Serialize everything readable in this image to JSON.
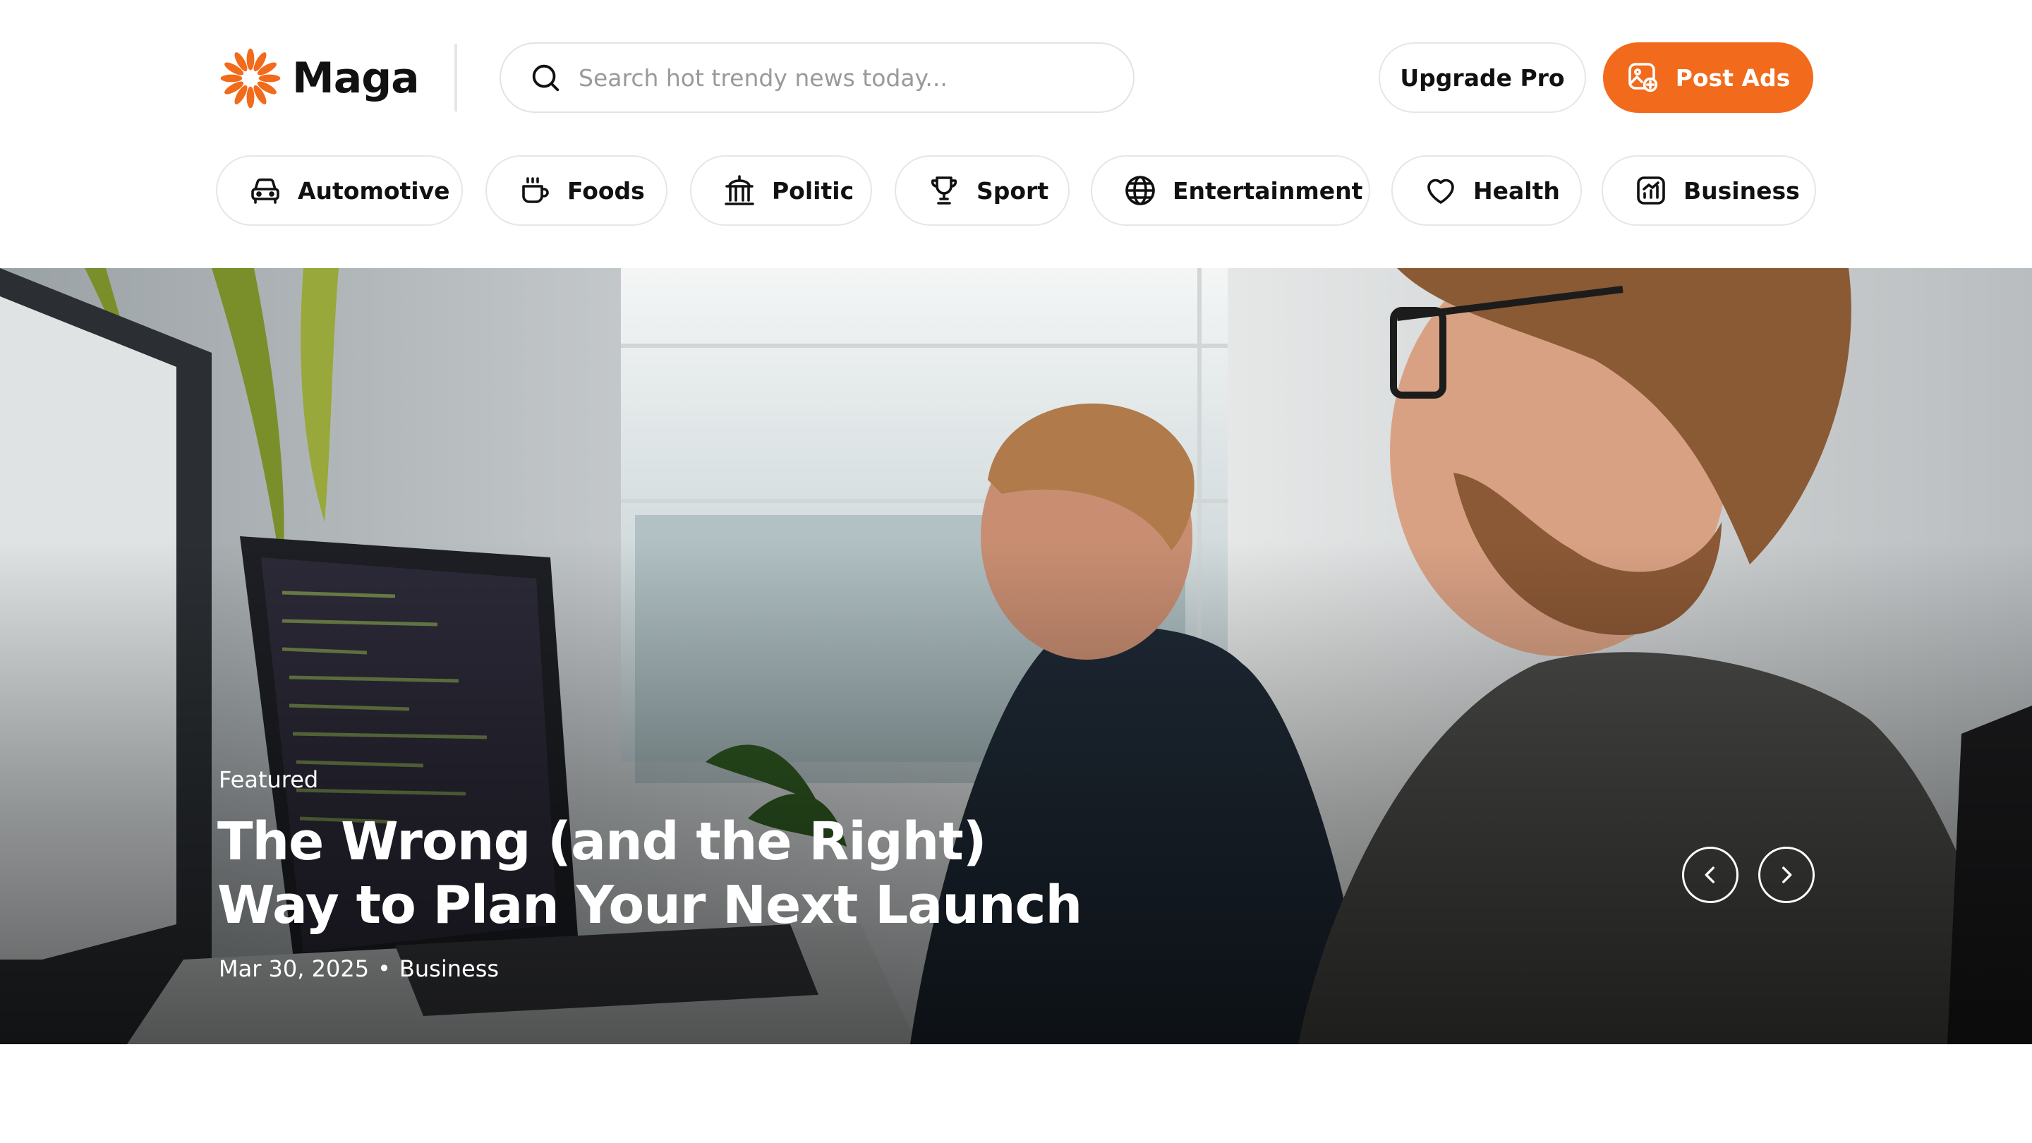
{
  "brand": {
    "name": "Maga",
    "accent_color": "#f26a1b",
    "logo_icon": "sunburst-icon"
  },
  "search": {
    "placeholder": "Search hot trendy news today...",
    "icon": "search-icon"
  },
  "actions": {
    "upgrade_label": "Upgrade Pro",
    "post_ads_label": "Post Ads",
    "post_ads_icon": "image-ad-icon"
  },
  "categories": [
    {
      "label": "Automotive",
      "icon": "car-icon"
    },
    {
      "label": "Foods",
      "icon": "coffee-cup-icon"
    },
    {
      "label": "Politic",
      "icon": "government-building-icon"
    },
    {
      "label": "Sport",
      "icon": "trophy-icon"
    },
    {
      "label": "Entertainment",
      "icon": "globe-icon"
    },
    {
      "label": "Health",
      "icon": "heart-icon"
    },
    {
      "label": "Business",
      "icon": "chart-icon"
    }
  ],
  "hero": {
    "eyebrow": "Featured",
    "title": "The Wrong (and the Right) Way to Plan Your Next Launch",
    "date": "Mar 30, 2025",
    "separator": "•",
    "category": "Business",
    "image_description_icon": "office-photo",
    "prev_icon": "chevron-left-icon",
    "next_icon": "chevron-right-icon"
  }
}
